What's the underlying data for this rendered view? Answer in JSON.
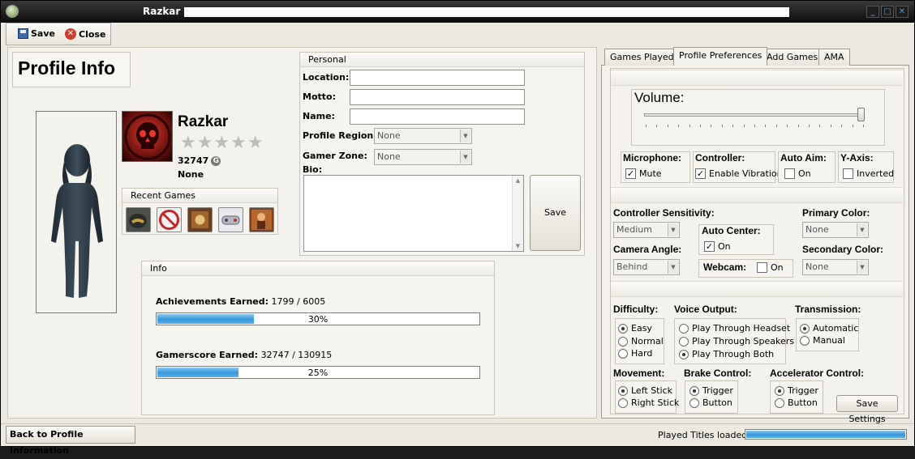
{
  "window": {
    "title": "Razkar -"
  },
  "toolbar": {
    "save_label": "Save",
    "close_label": "Close"
  },
  "profile": {
    "heading": "Profile Info",
    "gamertag": "Razkar",
    "stars": "★★★★★",
    "gamerscore": "32747",
    "gamerscore_badge": "G",
    "motto": "None",
    "recent_games_label": "Recent Games"
  },
  "personal": {
    "group_label": "Personal",
    "location_label": "Location:",
    "location_value": "",
    "motto_label": "Motto:",
    "motto_value": "",
    "name_label": "Name:",
    "name_value": "",
    "region_label": "Profile Region:",
    "region_value": "None",
    "zone_label": "Gamer Zone:",
    "zone_value": "None",
    "bio_label": "Bio:",
    "bio_value": "",
    "save_label": "Save"
  },
  "info": {
    "group_label": "Info",
    "achievements_label": "Achievements Earned:",
    "achievements_value": "1799 / 6005",
    "achievements_pct": 30,
    "achievements_pct_text": "30%",
    "gamerscore_label": "Gamerscore Earned:",
    "gamerscore_value": "32747 / 130915",
    "gamerscore_pct": 25,
    "gamerscore_pct_text": "25%"
  },
  "tabs": [
    "Games Played",
    "Profile Preferences",
    "Add Games",
    "AMA"
  ],
  "prefs": {
    "volume_label": "Volume:",
    "volume_level": 0.99,
    "microphone_label": "Microphone:",
    "mute_label": "Mute",
    "controller_label": "Controller:",
    "vibration_label": "Enable Vibration",
    "autoaim_label": "Auto Aim:",
    "autoaim_on_label": "On",
    "yaxis_label": "Y-Axis:",
    "inverted_label": "Inverted",
    "sensitivity_label": "Controller Sensitivity:",
    "sensitivity_value": "Medium",
    "autocenter_label": "Auto Center:",
    "autocenter_on_label": "On",
    "primary_color_label": "Primary Color:",
    "primary_color_value": "None",
    "camera_label": "Camera Angle:",
    "camera_value": "Behind",
    "webcam_label": "Webcam:",
    "webcam_on_label": "On",
    "secondary_color_label": "Secondary Color:",
    "secondary_color_value": "None",
    "difficulty_label": "Difficulty:",
    "difficulty_options": [
      "Easy",
      "Normal",
      "Hard"
    ],
    "voice_label": "Voice Output:",
    "voice_options": [
      "Play Through Headset",
      "Play Through Speakers",
      "Play Through Both"
    ],
    "transmission_label": "Transmission:",
    "transmission_options": [
      "Automatic",
      "Manual"
    ],
    "movement_label": "Movement:",
    "movement_options": [
      "Left Stick",
      "Right Stick"
    ],
    "brake_label": "Brake Control:",
    "brake_options": [
      "Trigger",
      "Button"
    ],
    "accel_label": "Accelerator Control:",
    "accel_options": [
      "Trigger",
      "Button"
    ],
    "save_settings_label": "Save Settings"
  },
  "status": {
    "back_label": "Back to Profile Information",
    "loaded_text": "Played Titles loaded!",
    "progress": 1.0
  }
}
